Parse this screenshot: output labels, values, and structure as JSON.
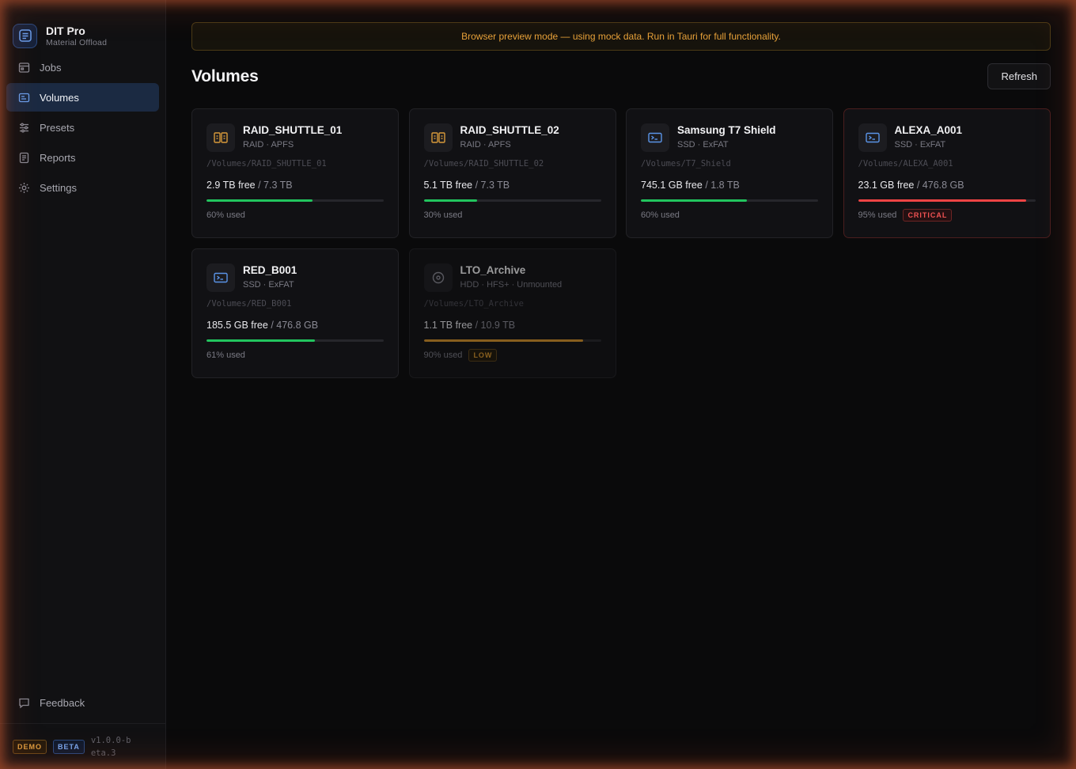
{
  "app": {
    "title": "DIT Pro",
    "subtitle": "Material Offload"
  },
  "sidebar": {
    "items": [
      {
        "label": "Jobs",
        "icon": "calendar-icon",
        "active": false
      },
      {
        "label": "Volumes",
        "icon": "drive-icon",
        "active": true
      },
      {
        "label": "Presets",
        "icon": "sliders-icon",
        "active": false
      },
      {
        "label": "Reports",
        "icon": "document-icon",
        "active": false
      },
      {
        "label": "Settings",
        "icon": "gear-icon",
        "active": false
      }
    ],
    "feedback_label": "Feedback",
    "demo_badge": "DEMO",
    "beta_badge": "BETA",
    "version": "v1.0.0-beta.3"
  },
  "banner": {
    "text": "Browser preview mode — using mock data. Run in Tauri for full functionality."
  },
  "header": {
    "title": "Volumes",
    "refresh_label": "Refresh"
  },
  "colors": {
    "ok": "#22c55e",
    "critical": "#ef4444",
    "low": "#d4922a",
    "accent": "#3b82f6"
  },
  "volumes": [
    {
      "name": "RAID_SHUTTLE_01",
      "meta": "RAID · APFS",
      "path": "/Volumes/RAID_SHUTTLE_01",
      "free": "2.9 TB free",
      "total": "/ 7.3 TB",
      "usage": "60% used",
      "used_fraction": 0.6,
      "status": "ok",
      "tag": "",
      "icon": "raid-icon"
    },
    {
      "name": "RAID_SHUTTLE_02",
      "meta": "RAID · APFS",
      "path": "/Volumes/RAID_SHUTTLE_02",
      "free": "5.1 TB free",
      "total": "/ 7.3 TB",
      "usage": "30% used",
      "used_fraction": 0.3,
      "status": "ok",
      "tag": "",
      "icon": "raid-icon"
    },
    {
      "name": "Samsung T7 Shield",
      "meta": "SSD · ExFAT",
      "path": "/Volumes/T7_Shield",
      "free": "745.1 GB free",
      "total": "/ 1.8 TB",
      "usage": "60% used",
      "used_fraction": 0.6,
      "status": "ok",
      "tag": "",
      "icon": "ssd-icon"
    },
    {
      "name": "ALEXA_A001",
      "meta": "SSD · ExFAT",
      "path": "/Volumes/ALEXA_A001",
      "free": "23.1 GB free",
      "total": "/ 476.8 GB",
      "usage": "95% used",
      "used_fraction": 0.95,
      "status": "critical",
      "tag": "CRITICAL",
      "icon": "ssd-icon"
    },
    {
      "name": "RED_B001",
      "meta": "SSD · ExFAT",
      "path": "/Volumes/RED_B001",
      "free": "185.5 GB free",
      "total": "/ 476.8 GB",
      "usage": "61% used",
      "used_fraction": 0.61,
      "status": "ok",
      "tag": "",
      "icon": "ssd-icon"
    },
    {
      "name": "LTO_Archive",
      "meta": "HDD · HFS+ · Unmounted",
      "path": "/Volumes/LTO_Archive",
      "free": "1.1 TB free",
      "total": "/ 10.9 TB",
      "usage": "90% used",
      "used_fraction": 0.9,
      "status": "low",
      "tag": "LOW",
      "icon": "hdd-icon"
    }
  ]
}
